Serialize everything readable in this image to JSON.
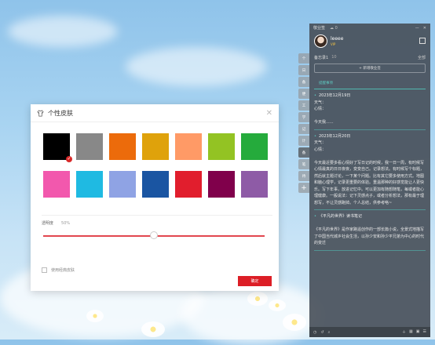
{
  "dialog": {
    "title": "个性皮肤",
    "close_glyph": "✕",
    "colors": [
      "#000000",
      "#888888",
      "#ec6b0b",
      "#dfa20b",
      "#ff9a66",
      "#93c323",
      "#25ab3c",
      "#f258ad",
      "#1fbae2",
      "#8fa3e4",
      "#1a55a2",
      "#e11e2d",
      "#80004b",
      "#8e5ba6"
    ],
    "selected_index": 0,
    "opacity_label": "透明度",
    "opacity_value": "50%",
    "opacity_fraction": 0.5,
    "classic_label": "使用经典皮肤",
    "confirm_label": "确定"
  },
  "side_tabs": [
    "个人",
    "日历",
    "备忘",
    "便签",
    "工作",
    "学习",
    "记账",
    "计划",
    "备忘",
    "笔记",
    "待办"
  ],
  "side_tab_active": 8,
  "side_add": "+",
  "app": {
    "title": "敬业签",
    "icons_top": "☁ ⚙ 🔔",
    "username": "leeee",
    "vip": "VIP",
    "list_title": "备忘录1",
    "list_count": "10",
    "filter": "全部",
    "new_button": "+ 新增敬业签",
    "reminder": "提醒事项",
    "entries": [
      {
        "date": "2023年12月19日",
        "lines": [
          "天气：",
          "心情：",
          "",
          "今天我......"
        ]
      },
      {
        "date": "2023年12月20日",
        "lines": [
          "天气：",
          "心情：",
          "",
          "今天最近要多看心情好了写日记的时候，我一日一周，有时候写心情最真的日日夜夜，变变自己。记录想法。有时候写个标题，然后就主题讨论，一下某个问题。比有其它要多使用方式。地图和脑心理学，记录更重要的体验。重温那种的好感觉能让人更快乐。写下年事，放进记忆中。可以更加有随想随笔，每或者能心理健康。一般说法：记下灵感点子，或者分析想法，那有最于理想写，不让灵感跑掉。个人总结，供参考咯~"
        ]
      },
      {
        "date": "《平凡的世界》读书笔记",
        "lines": [
          "",
          "《平凡的世界》是作家路遥创作的一部长篇小说，全景式地描写了中国当代城乡社会生活，以孙少安和孙少平兄弟为中心的时代的变迁"
        ]
      }
    ]
  }
}
